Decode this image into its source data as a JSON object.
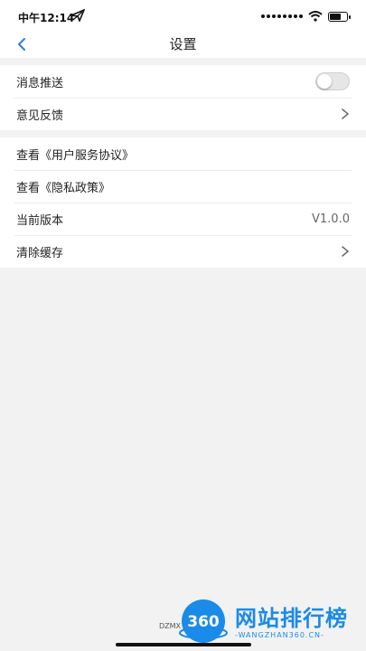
{
  "status_bar": {
    "time": "中午12:14"
  },
  "nav": {
    "title": "设置"
  },
  "group1": [
    {
      "label": "消息推送",
      "toggle_on": false
    },
    {
      "label": "意见反馈"
    }
  ],
  "group2": [
    {
      "label": "查看《用户服务协议》"
    },
    {
      "label": "查看《隐私政策》"
    },
    {
      "label": "当前版本",
      "value": "V1.0.0"
    },
    {
      "label": "清除缓存"
    }
  ],
  "footer": {
    "text": "DZMX"
  },
  "watermark": {
    "logo_text": "360",
    "title": "网站排行榜",
    "subtitle": "-WANGZHAN360.CN-"
  },
  "colors": {
    "watermark_blue": "#1a8be8",
    "background": "#f2f2f2",
    "accent_back": "#2f7bd8"
  }
}
